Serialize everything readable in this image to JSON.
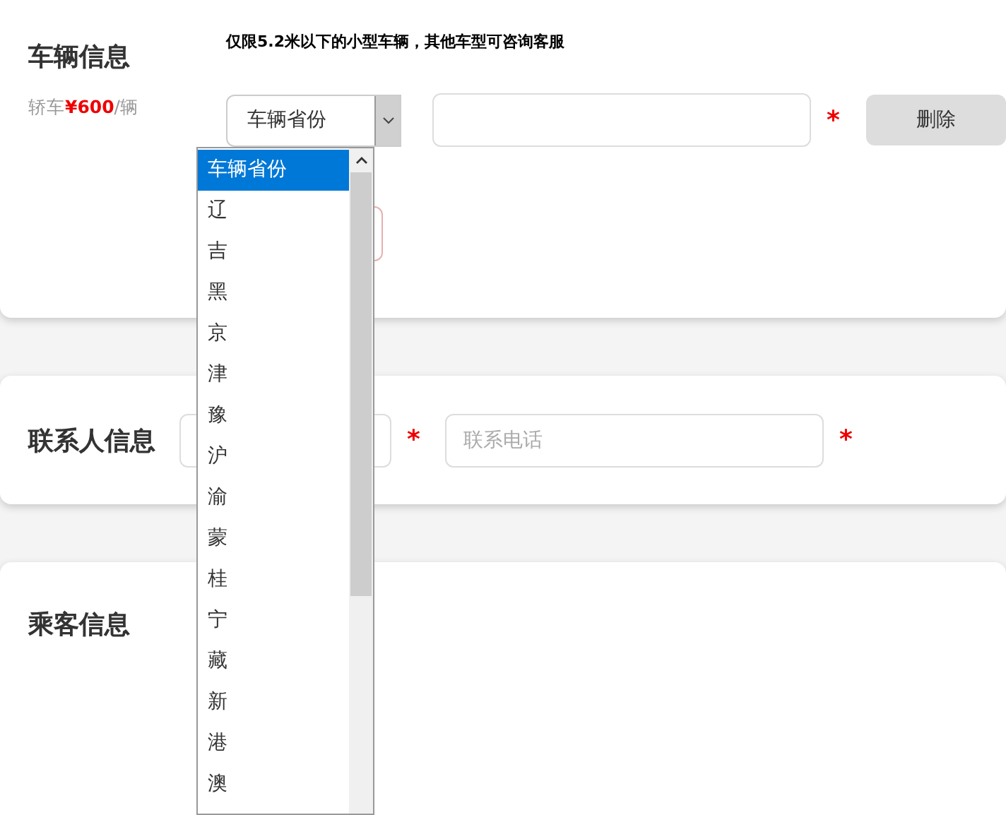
{
  "vehicle_section": {
    "title": "车辆信息",
    "notice": "仅限5.2米以下的小型车辆，其他车型可咨询客服",
    "price": "轿车**¥600**/辆",
    "province_select": {
      "value": "车辆省份",
      "expanded": true,
      "options": [
        {
          "label": "车辆省份",
          "selected": true
        },
        {
          "label": "辽",
          "selected": false
        },
        {
          "label": "吉",
          "selected": false
        },
        {
          "label": "黑",
          "selected": false
        },
        {
          "label": "京",
          "selected": false
        },
        {
          "label": "津",
          "selected": false
        },
        {
          "label": "豫",
          "selected": false
        },
        {
          "label": "沪",
          "selected": false
        },
        {
          "label": "渝",
          "selected": false
        },
        {
          "label": "蒙",
          "selected": false
        },
        {
          "label": "桂",
          "selected": false
        },
        {
          "label": "宁",
          "selected": false
        },
        {
          "label": "藏",
          "selected": false
        },
        {
          "label": "新",
          "selected": false
        },
        {
          "label": "港",
          "selected": false
        },
        {
          "label": "澳",
          "selected": false
        }
      ]
    },
    "plate_field": {
      "required_mark": "*"
    },
    "delete_button": "删除"
  },
  "contact_section": {
    "title": "联系人信息",
    "name_field": {
      "required_mark": "*"
    },
    "phone_field": {
      "placeholder": "联系电话",
      "required_mark": "*"
    }
  },
  "passenger_section": {
    "title": "乘客信息"
  }
}
